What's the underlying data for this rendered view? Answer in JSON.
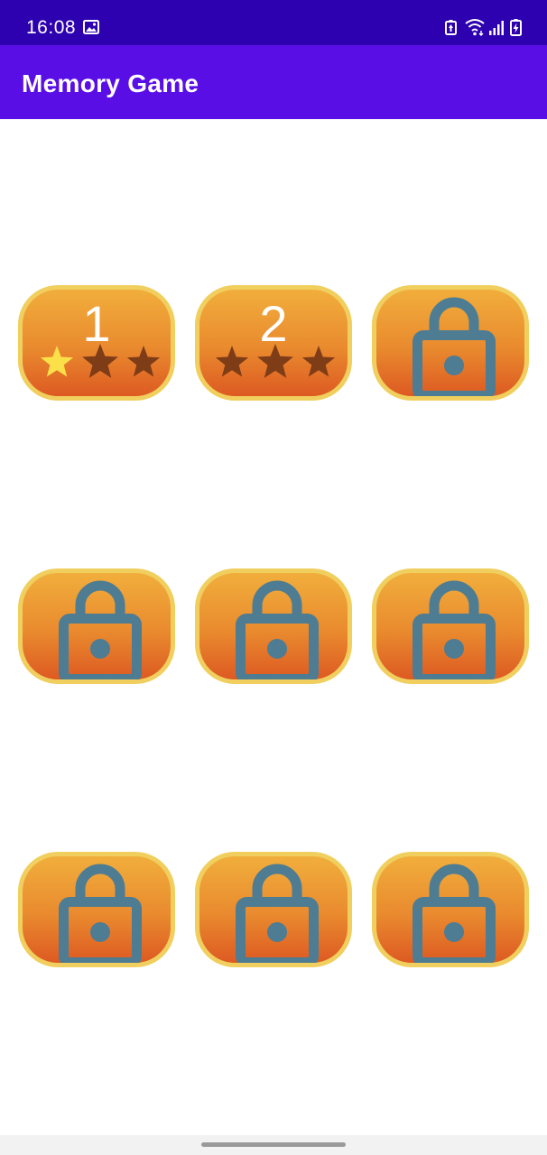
{
  "status_bar": {
    "time": "16:08",
    "icons": [
      "image-icon",
      "battery-saver-icon",
      "wifi-icon",
      "signal-icon",
      "battery-charging-icon"
    ]
  },
  "app_bar": {
    "title": "Memory Game"
  },
  "levels": [
    {
      "number": "1",
      "locked": false,
      "stars_earned": 1,
      "stars_total": 3
    },
    {
      "number": "2",
      "locked": false,
      "stars_earned": 0,
      "stars_total": 3
    },
    {
      "locked": true,
      "icon": "lock-icon"
    },
    {
      "locked": true,
      "icon": "lock-icon"
    },
    {
      "locked": true,
      "icon": "lock-icon"
    },
    {
      "locked": true,
      "icon": "lock-icon"
    },
    {
      "locked": true,
      "icon": "lock-icon"
    },
    {
      "locked": true,
      "icon": "lock-icon"
    },
    {
      "locked": true,
      "icon": "lock-icon"
    }
  ],
  "colors": {
    "status_bar": "#2d00b0",
    "app_bar": "#5a0ee6",
    "button_border": "#f0cf5e",
    "button_top": "#f1ae3c",
    "button_bottom": "#dd5a22",
    "star_earned": "#fbe04a",
    "star_empty": "#7e3c17",
    "lock": "#4d7c93"
  }
}
